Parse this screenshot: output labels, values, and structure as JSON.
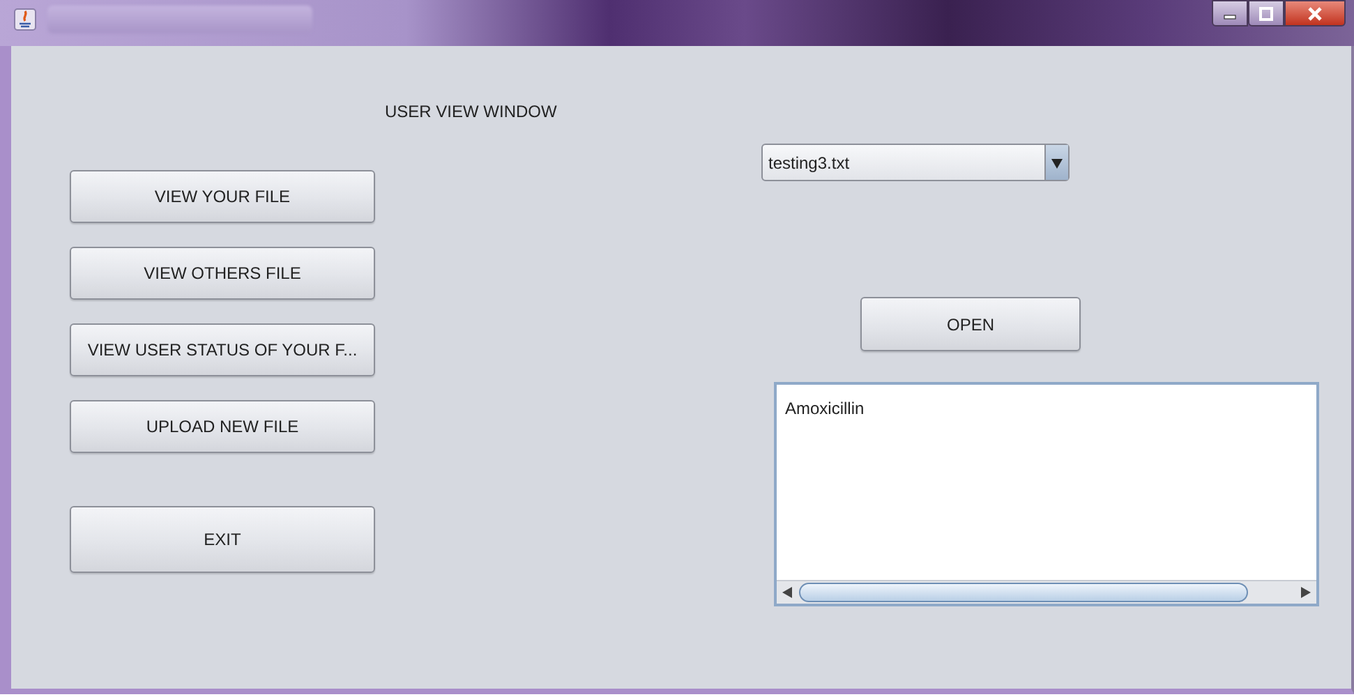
{
  "heading": "USER VIEW WINDOW",
  "menu_buttons": [
    "VIEW YOUR FILE",
    "VIEW OTHERS FILE",
    "VIEW USER STATUS OF YOUR F...",
    "UPLOAD NEW FILE"
  ],
  "exit_button": "EXIT",
  "file_select": {
    "value": "testing3.txt"
  },
  "open_button": "OPEN",
  "file_content": "Amoxicillin"
}
